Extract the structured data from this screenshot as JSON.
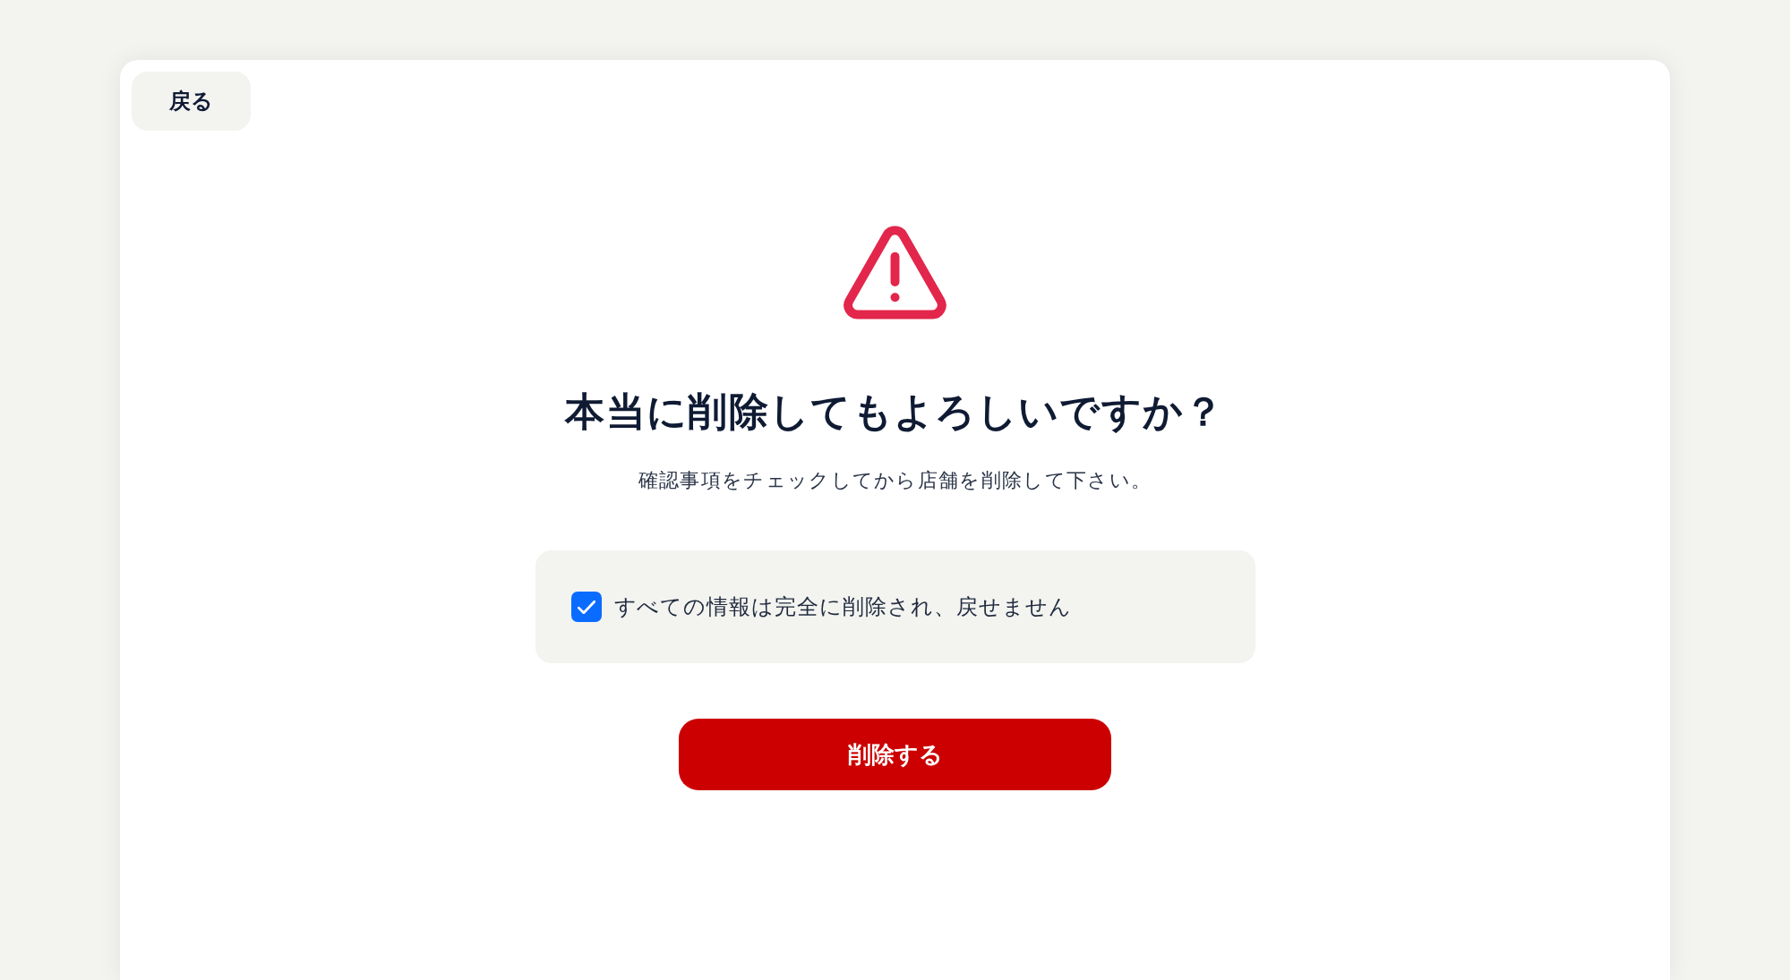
{
  "back_button": {
    "label": "戻る"
  },
  "dialog": {
    "title": "本当に削除してもよろしいですか？",
    "description": "確認事項をチェックしてから店舗を削除して下さい。",
    "confirmations": [
      {
        "label": "すべての情報は完全に削除され、戻せません",
        "checked": true
      }
    ],
    "submit_button": {
      "label": "削除する"
    }
  }
}
